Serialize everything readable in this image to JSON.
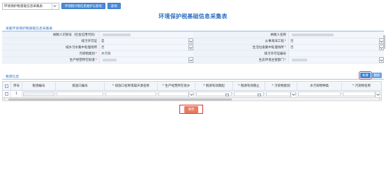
{
  "toolbar": {
    "form_select": "环境保护税基础信息采集表",
    "btn_tax_source": "环保税计税信息维护与查询",
    "btn_query": "查询"
  },
  "title": "环境保护税基础信息采集表",
  "section1": {
    "label": "采集环境保护税基础信息采集表",
    "rows": [
      {
        "l1": "纳税人识别号（社会信用代码）",
        "v1": "",
        "l2": "纳税人名称",
        "v2": "",
        "req2": false
      },
      {
        "l1": "排污许可证",
        "v1": "是",
        "dd1": true,
        "l2": "从事海洋工程",
        "req2": true,
        "v2": "否",
        "dd2": true
      },
      {
        "l1": "城乡污水集中处理场所",
        "v1": "否",
        "dd1": true,
        "l2": "生活垃圾集中处理场所",
        "req2": true,
        "v2": "否",
        "dd2": true
      },
      {
        "l1": "污染物类别",
        "req1": true,
        "v1": "水污染",
        "l2": "排污许可证编号",
        "v2": ""
      },
      {
        "l1": "生产经营所在街道",
        "req1": true,
        "v1": "",
        "dd1": true,
        "l2": "生态环境主管部门",
        "req2": true,
        "v2": "",
        "dd2": true
      }
    ]
  },
  "section2": {
    "label": "税源信息",
    "add_button": "新增",
    "delete_button": "删除",
    "headers": [
      "序号",
      "税源编号",
      "排放口编号",
      "* 排放口名称或噪声源名称",
      "* 生产经营所在街乡",
      "* 税源有效期起",
      "* 税源有效期止",
      "* 污染物类别",
      "水污染物种类",
      "* 污染物名称"
    ],
    "rows": [
      {
        "index": "1",
        "source_no": "",
        "outlet_no": "",
        "outlet_name": "",
        "street": "",
        "valid_from": "",
        "valid_to": "",
        "category": "",
        "water_kind": "",
        "pollutant": ""
      }
    ]
  },
  "save_button": "保存",
  "colors": {
    "accent": "#2b6ebf",
    "save": "#e97b5f",
    "highlight": "#e0312f"
  }
}
